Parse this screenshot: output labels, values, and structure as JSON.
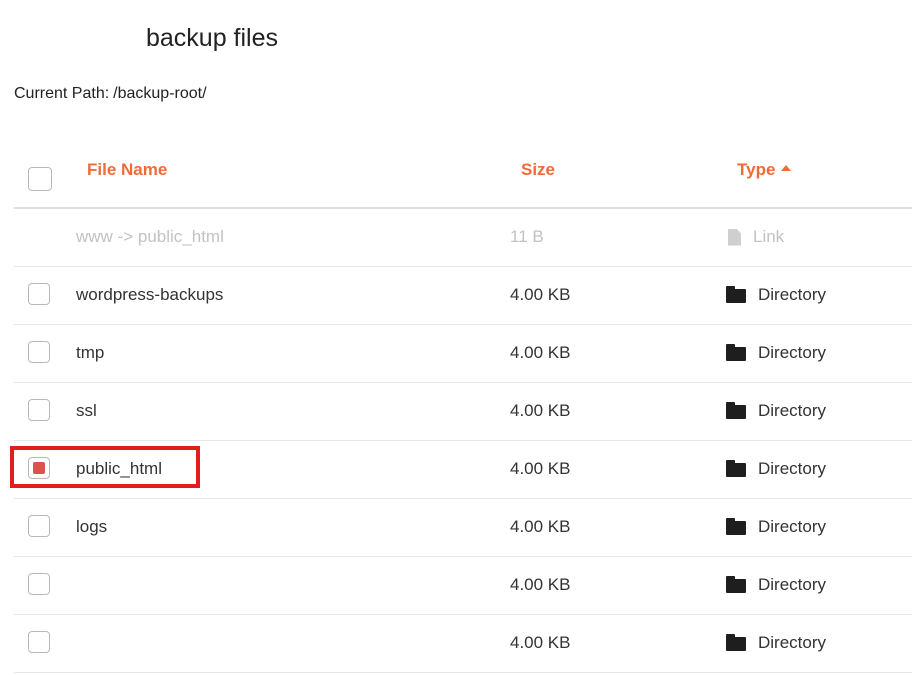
{
  "page": {
    "title": "backup files",
    "path_label": "Current Path:",
    "path_value": "/backup-root/"
  },
  "table": {
    "columns": {
      "name": "File Name",
      "size": "Size",
      "type": "Type"
    },
    "sort": {
      "column": "type",
      "direction": "ascending"
    },
    "rows": [
      {
        "name": "www -> public_html",
        "size": "11 B",
        "type": "Link",
        "icon": "file-icon",
        "selectable": false,
        "checked": false
      },
      {
        "name": "wordpress-backups",
        "size": "4.00 KB",
        "type": "Directory",
        "icon": "folder-icon",
        "selectable": true,
        "checked": false
      },
      {
        "name": "tmp",
        "size": "4.00 KB",
        "type": "Directory",
        "icon": "folder-icon",
        "selectable": true,
        "checked": false
      },
      {
        "name": "ssl",
        "size": "4.00 KB",
        "type": "Directory",
        "icon": "folder-icon",
        "selectable": true,
        "checked": false
      },
      {
        "name": "public_html",
        "size": "4.00 KB",
        "type": "Directory",
        "icon": "folder-icon",
        "selectable": true,
        "checked": true
      },
      {
        "name": "logs",
        "size": "4.00 KB",
        "type": "Directory",
        "icon": "folder-icon",
        "selectable": true,
        "checked": false
      },
      {
        "name": "",
        "size": "4.00 KB",
        "type": "Directory",
        "icon": "folder-icon",
        "selectable": true,
        "checked": false
      },
      {
        "name": "",
        "size": "4.00 KB",
        "type": "Directory",
        "icon": "folder-icon",
        "selectable": true,
        "checked": false
      }
    ]
  },
  "colors": {
    "accent": "#f26b37",
    "checked": "#d9534f",
    "highlight": "#e01e1e",
    "muted_text": "#c2c2c2"
  }
}
